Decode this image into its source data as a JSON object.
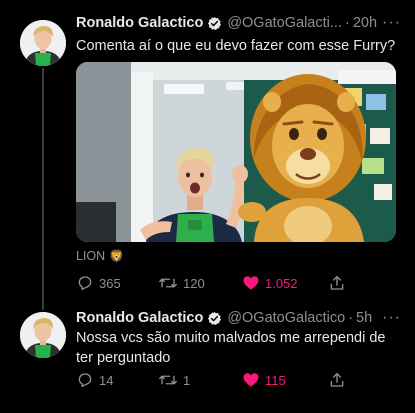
{
  "tweets": [
    {
      "author": {
        "display_name": "Ronaldo Galactico",
        "handle": "@OGatoGalacti...",
        "verified": true
      },
      "time": "20h",
      "text": "Comenta aí o que eu devo fazer com esse Furry?",
      "media": {
        "caption": "LION",
        "caption_emoji": "🦁"
      },
      "stats": {
        "replies": "365",
        "retweets": "120",
        "likes": "1.052",
        "liked": true
      }
    },
    {
      "author": {
        "display_name": "Ronaldo Galactico",
        "handle": "@OGatoGalactico",
        "verified": true
      },
      "time": "5h",
      "text": "Nossa vcs são muito malvados me arrependi de ter perguntado",
      "stats": {
        "replies": "14",
        "retweets": "1",
        "likes": "115",
        "liked": true
      }
    }
  ],
  "icons": {
    "more": "more-dots-icon",
    "reply": "reply-icon",
    "retweet": "retweet-icon",
    "like": "heart-icon",
    "share": "share-icon",
    "verified": "verified-badge-icon"
  },
  "colors": {
    "background": "#000000",
    "text": "#e7e9ea",
    "secondary_text": "#8b9197",
    "like_active": "#f91880",
    "thread_line": "#3a3d40"
  }
}
